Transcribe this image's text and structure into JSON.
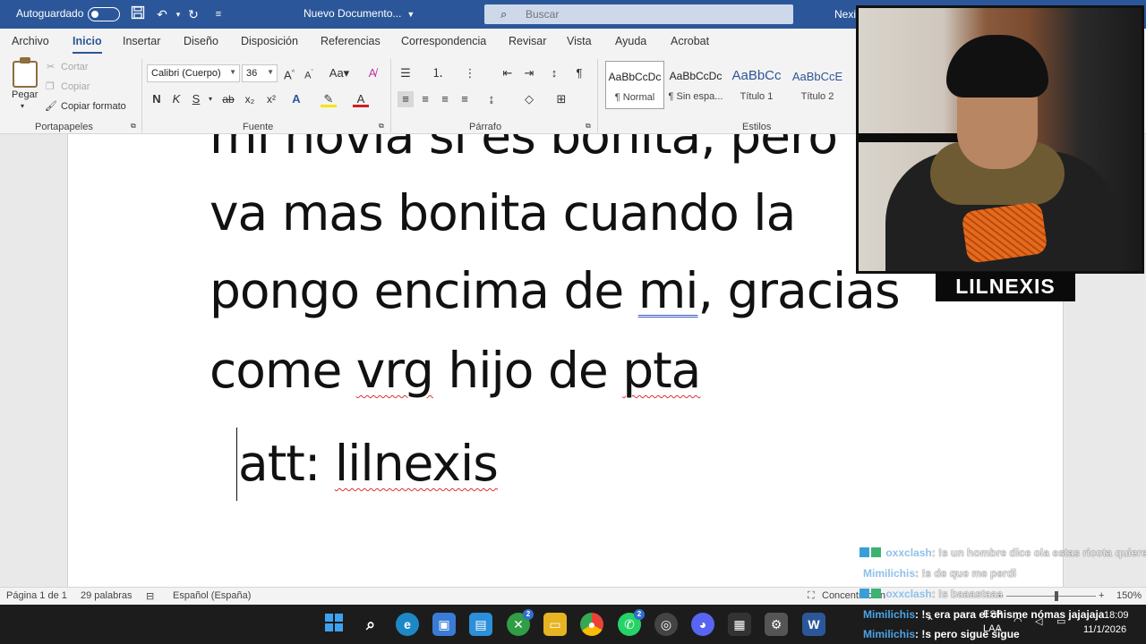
{
  "titlebar": {
    "autosave_label": "Autoguardado",
    "doc_title": "Nuevo Documento...",
    "search_placeholder": "Buscar",
    "user_name": "Nexi"
  },
  "tabs": [
    "Archivo",
    "Inicio",
    "Insertar",
    "Diseño",
    "Disposición",
    "Referencias",
    "Correspondencia",
    "Revisar",
    "Vista",
    "Ayuda",
    "Acrobat"
  ],
  "active_tab": "Inicio",
  "ribbon": {
    "clipboard": {
      "paste": "Pegar",
      "cut": "Cortar",
      "copy": "Copiar",
      "format_painter": "Copiar formato",
      "group": "Portapapeles"
    },
    "font": {
      "family": "Calibri (Cuerpo)",
      "size": "36",
      "group": "Fuente"
    },
    "paragraph": {
      "group": "Párrafo"
    },
    "styles": {
      "group": "Estilos",
      "items": [
        {
          "preview": "AaBbCcDc",
          "name": "¶ Normal"
        },
        {
          "preview": "AaBbCcDc",
          "name": "¶ Sin espa..."
        },
        {
          "preview": "AaBbCc",
          "name": "Título 1"
        },
        {
          "preview": "AaBbCcE",
          "name": "Título 2"
        }
      ]
    }
  },
  "document": {
    "lines": [
      "mi novia si es bonita, pero",
      "va mas bonita cuando la",
      "pongo encima de mi, gracias",
      "come vrg hijo de pta"
    ],
    "signature": "att: lilnexis"
  },
  "statusbar": {
    "page": "Página 1 de 1",
    "words": "29 palabras",
    "language": "Español (España)",
    "focus": "Concentración",
    "zoom": "150%"
  },
  "taskbar": {
    "time": "18:09",
    "date": "11/1/2026",
    "lang": "ESP",
    "lang2": "LAA"
  },
  "overlay": {
    "streamer_name": "LILNEXIS",
    "chat": [
      {
        "user": "oxxclash",
        "message": ": !s un hombre dice ola estas ricota quieres"
      },
      {
        "user": "Mimilichis",
        "message": ": !s de que me perdi"
      },
      {
        "user": "oxxclash",
        "message": ": !s baaastaaa"
      },
      {
        "user": "Mimilichis",
        "message": ": !s era para el chisme nómas jajajaja"
      },
      {
        "user": "Mimilichis",
        "message": ": !s pero sigue sigue"
      }
    ]
  },
  "colors": {
    "word_blue": "#2b579a",
    "spell_error": "#d9303a"
  }
}
